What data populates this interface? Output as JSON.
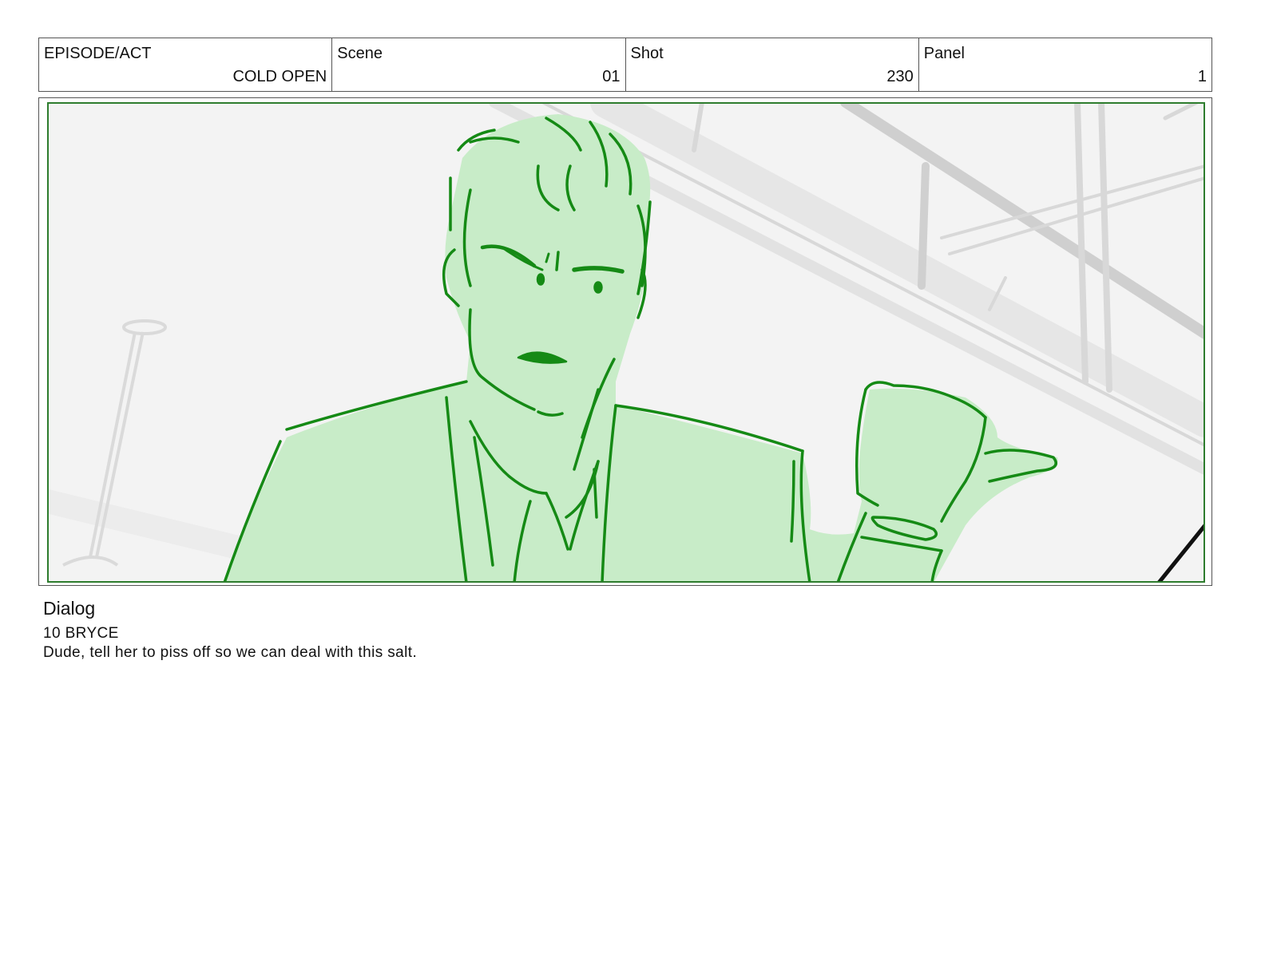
{
  "header": {
    "cells": [
      {
        "label": "EPISODE/ACT",
        "value": "COLD OPEN"
      },
      {
        "label": "Scene",
        "value": "01"
      },
      {
        "label": "Shot",
        "value": "230"
      },
      {
        "label": "Panel",
        "value": "1"
      }
    ]
  },
  "panel": {
    "colors": {
      "character_fill": "#c8ecc8",
      "character_line": "#158a15",
      "safe_frame": "#2e7d2e",
      "background": "#f3f3f3",
      "background_lines": "#d6d6d6"
    }
  },
  "dialog": {
    "heading": "Dialog",
    "speaker": "10 BRYCE",
    "line": "Dude, tell her to piss off so we can deal with this salt."
  }
}
